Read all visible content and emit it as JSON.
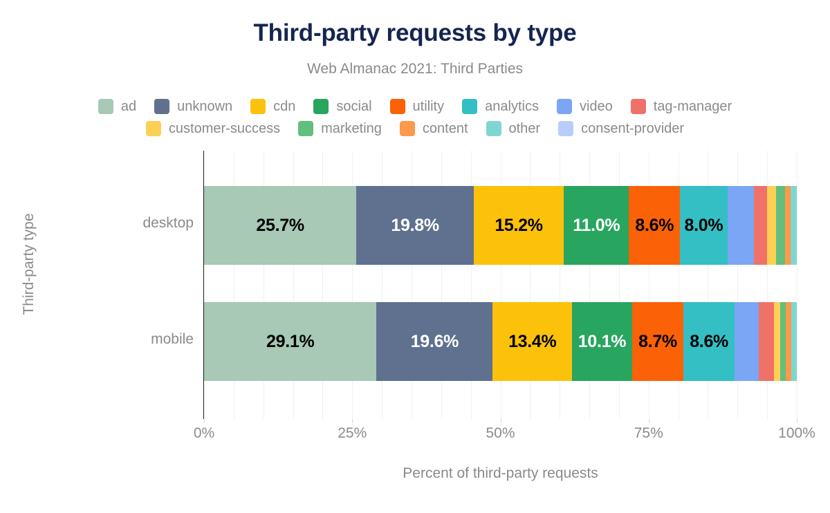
{
  "chart_data": {
    "type": "bar",
    "orientation": "horizontal",
    "stacked": true,
    "normalized": true,
    "title": "Third-party requests by type",
    "subtitle": "Web Almanac 2021: Third Parties",
    "xlabel": "Percent of third-party requests",
    "ylabel": "Third-party type",
    "xlim": [
      0,
      100
    ],
    "xticks": [
      "0%",
      "25%",
      "50%",
      "75%",
      "100%"
    ],
    "xtick_values": [
      0,
      25,
      50,
      75,
      100
    ],
    "grid": true,
    "grid_step": 5,
    "legend_position": "top",
    "categories": [
      "desktop",
      "mobile"
    ],
    "series": [
      {
        "name": "ad",
        "color": "#a7c9b5",
        "values": [
          25.7,
          29.1
        ],
        "labels": [
          "25.7%",
          "29.1%"
        ],
        "label_color": "dark"
      },
      {
        "name": "unknown",
        "color": "#5f718f",
        "values": [
          19.8,
          19.6
        ],
        "labels": [
          "19.8%",
          "19.6%"
        ],
        "label_color": "light"
      },
      {
        "name": "cdn",
        "color": "#fbc10b",
        "values": [
          15.2,
          13.4
        ],
        "labels": [
          "15.2%",
          "13.4%"
        ],
        "label_color": "dark"
      },
      {
        "name": "social",
        "color": "#28a55f",
        "values": [
          11.0,
          10.1
        ],
        "labels": [
          "11.0%",
          "10.1%"
        ],
        "label_color": "light"
      },
      {
        "name": "utility",
        "color": "#fb6107",
        "values": [
          8.6,
          8.7
        ],
        "labels": [
          "8.6%",
          "8.7%"
        ],
        "label_color": "dark"
      },
      {
        "name": "analytics",
        "color": "#33bfc4",
        "values": [
          8.0,
          8.6
        ],
        "labels": [
          "8.0%",
          "8.6%"
        ],
        "label_color": "dark"
      },
      {
        "name": "video",
        "color": "#7aa6f5",
        "values": [
          4.5,
          4.1
        ],
        "labels": [
          "",
          ""
        ],
        "label_color": "dark"
      },
      {
        "name": "tag-manager",
        "color": "#f07167",
        "values": [
          2.2,
          2.5
        ],
        "labels": [
          "",
          ""
        ],
        "label_color": "dark"
      },
      {
        "name": "customer-success",
        "color": "#fcd055",
        "values": [
          1.5,
          1.1
        ],
        "labels": [
          "",
          ""
        ],
        "label_color": "dark"
      },
      {
        "name": "marketing",
        "color": "#62bf7e",
        "values": [
          1.5,
          1.0
        ],
        "labels": [
          "",
          ""
        ],
        "label_color": "dark"
      },
      {
        "name": "content",
        "color": "#fb9a4b",
        "values": [
          1.0,
          0.9
        ],
        "labels": [
          "",
          ""
        ],
        "label_color": "dark"
      },
      {
        "name": "other",
        "color": "#7fd6d1",
        "values": [
          1.0,
          0.9
        ],
        "labels": [
          "",
          ""
        ],
        "label_color": "dark"
      },
      {
        "name": "consent-provider",
        "color": "#b8cdfa",
        "values": [
          0.0,
          0.0
        ],
        "labels": [
          "",
          ""
        ],
        "label_color": "dark"
      }
    ]
  },
  "legend": {
    "rows": [
      [
        {
          "label": "ad",
          "color": "#a7c9b5"
        },
        {
          "label": "unknown",
          "color": "#5f718f"
        },
        {
          "label": "cdn",
          "color": "#fbc10b"
        },
        {
          "label": "social",
          "color": "#28a55f"
        },
        {
          "label": "utility",
          "color": "#fb6107"
        },
        {
          "label": "analytics",
          "color": "#33bfc4"
        },
        {
          "label": "video",
          "color": "#7aa6f5"
        },
        {
          "label": "tag-manager",
          "color": "#f07167"
        }
      ],
      [
        {
          "label": "customer-success",
          "color": "#fcd055"
        },
        {
          "label": "marketing",
          "color": "#62bf7e"
        },
        {
          "label": "content",
          "color": "#fb9a4b"
        },
        {
          "label": "other",
          "color": "#7fd6d1"
        },
        {
          "label": "consent-provider",
          "color": "#b8cdfa"
        }
      ]
    ]
  },
  "colors": {
    "title": "#152550",
    "muted_text": "#8a8a8a",
    "axis_line": "#1b1b1b",
    "gridline": "#f0f0f0",
    "background": "#ffffff"
  }
}
